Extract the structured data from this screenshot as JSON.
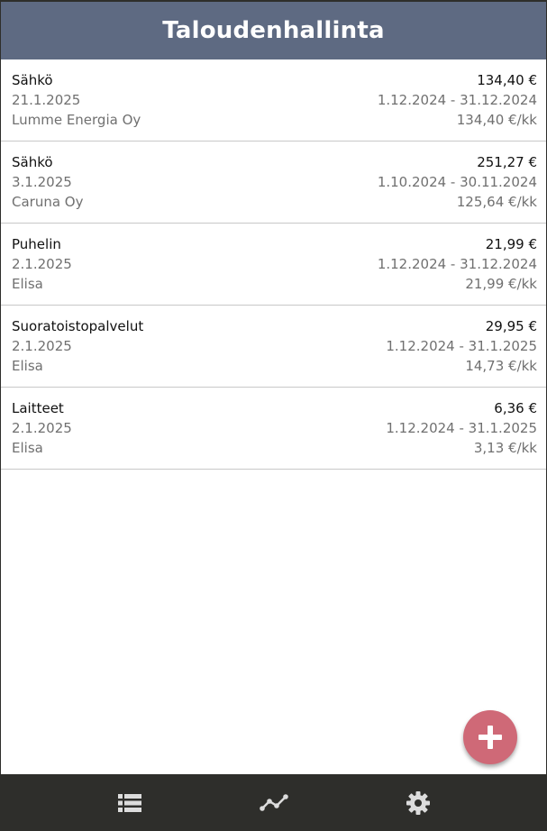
{
  "header": {
    "title": "Taloudenhallinta"
  },
  "bills": [
    {
      "category": "Sähkö",
      "amount": "134,40 €",
      "date": "21.1.2025",
      "period": "1.12.2024 - 31.12.2024",
      "company": "Lumme Energia Oy",
      "monthly": "134,40 €/kk"
    },
    {
      "category": "Sähkö",
      "amount": "251,27 €",
      "date": "3.1.2025",
      "period": "1.10.2024 - 30.11.2024",
      "company": "Caruna Oy",
      "monthly": "125,64 €/kk"
    },
    {
      "category": "Puhelin",
      "amount": "21,99 €",
      "date": "2.1.2025",
      "period": "1.12.2024 - 31.12.2024",
      "company": "Elisa",
      "monthly": "21,99 €/kk"
    },
    {
      "category": "Suoratoistopalvelut",
      "amount": "29,95 €",
      "date": "2.1.2025",
      "period": "1.12.2024 - 31.1.2025",
      "company": "Elisa",
      "monthly": "14,73 €/kk"
    },
    {
      "category": "Laitteet",
      "amount": "6,36 €",
      "date": "2.1.2025",
      "period": "1.12.2024 - 31.1.2025",
      "company": "Elisa",
      "monthly": "3,13 €/kk"
    }
  ],
  "fab": {
    "icon": "plus-icon"
  },
  "nav": [
    {
      "icon": "list-icon",
      "active": true
    },
    {
      "icon": "chart-line-icon",
      "active": false
    },
    {
      "icon": "gear-icon",
      "active": false
    }
  ],
  "colors": {
    "header_bg": "#5e6a82",
    "fab_bg": "#cf6977",
    "nav_bg": "#2e2e2b",
    "nav_icon": "#dcdcdc"
  }
}
